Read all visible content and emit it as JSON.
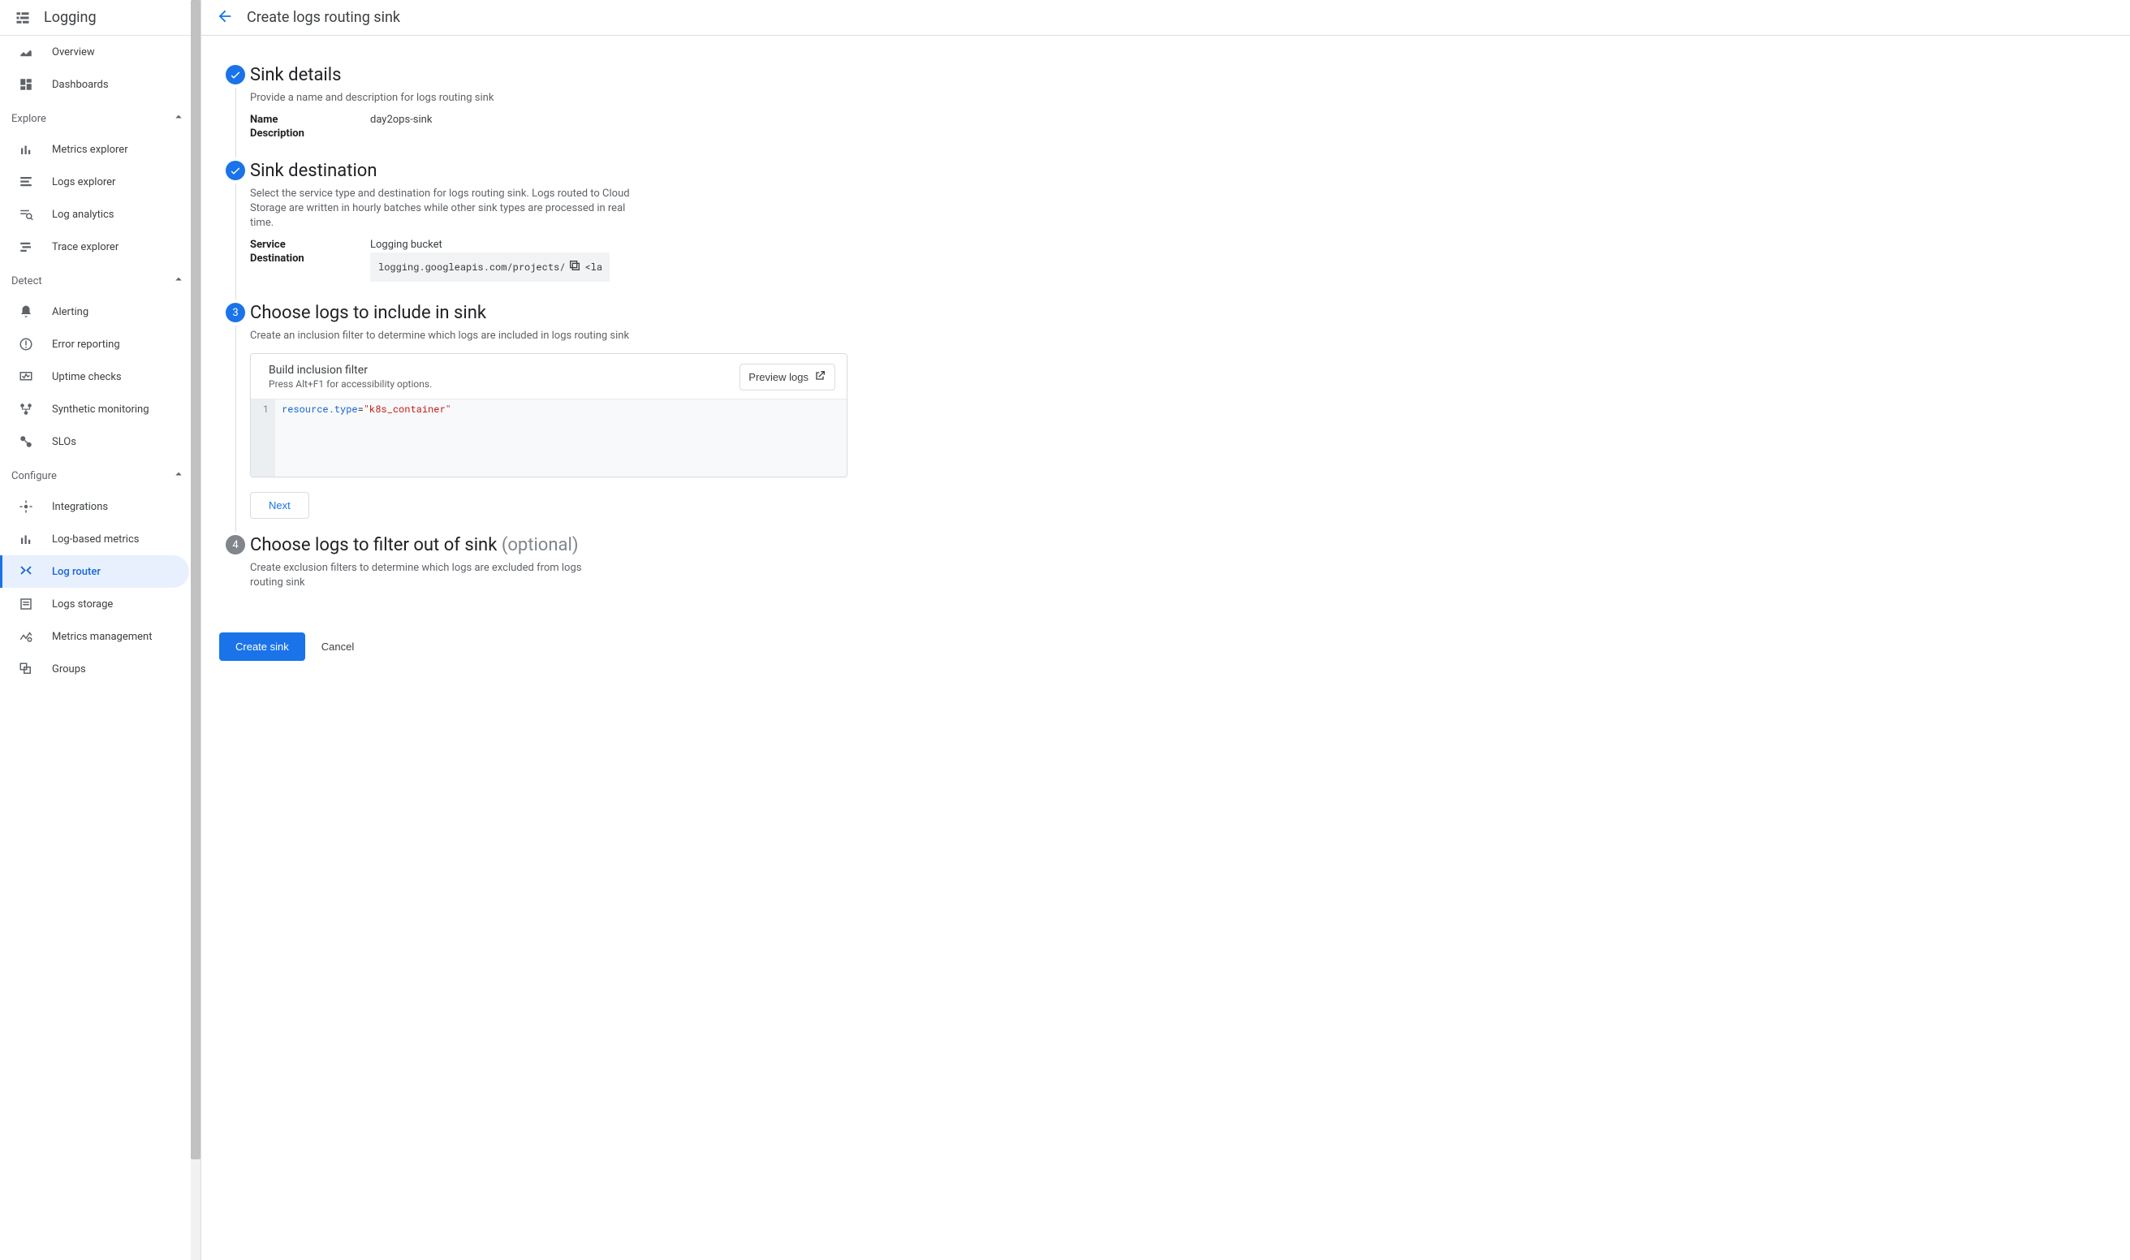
{
  "product": {
    "title": "Logging"
  },
  "header": {
    "page_title": "Create logs routing sink"
  },
  "sidebar": {
    "top": [
      {
        "label": "Overview",
        "icon": "insights"
      },
      {
        "label": "Dashboards",
        "icon": "dashboard"
      }
    ],
    "sections": {
      "explore": {
        "title": "Explore",
        "items": [
          {
            "label": "Metrics explorer",
            "icon": "bars"
          },
          {
            "label": "Logs explorer",
            "icon": "logs"
          },
          {
            "label": "Log analytics",
            "icon": "analytics"
          },
          {
            "label": "Trace explorer",
            "icon": "trace"
          }
        ]
      },
      "detect": {
        "title": "Detect",
        "items": [
          {
            "label": "Alerting",
            "icon": "bell"
          },
          {
            "label": "Error reporting",
            "icon": "error"
          },
          {
            "label": "Uptime checks",
            "icon": "uptime"
          },
          {
            "label": "Synthetic monitoring",
            "icon": "synthetic"
          },
          {
            "label": "SLOs",
            "icon": "slo"
          }
        ]
      },
      "configure": {
        "title": "Configure",
        "items": [
          {
            "label": "Integrations",
            "icon": "integrations"
          },
          {
            "label": "Log-based metrics",
            "icon": "bars"
          },
          {
            "label": "Log router",
            "icon": "router",
            "selected": true
          },
          {
            "label": "Logs storage",
            "icon": "storage"
          },
          {
            "label": "Metrics management",
            "icon": "mm"
          },
          {
            "label": "Groups",
            "icon": "groups"
          }
        ]
      }
    }
  },
  "steps": {
    "s1": {
      "title": "Sink details",
      "subtitle": "Provide a name and description for logs routing sink",
      "name_label": "Name",
      "name_value": "day2ops-sink",
      "desc_label": "Description",
      "desc_value": ""
    },
    "s2": {
      "title": "Sink destination",
      "subtitle": "Select the service type and destination for logs routing sink. Logs routed to Cloud Storage are written in hourly batches while other sink types are processed in real time.",
      "service_label": "Service",
      "service_value": "Logging bucket",
      "dest_label": "Destination",
      "dest_value": "logging.googleapis.com/projects/",
      "dest_tail": "<la"
    },
    "s3": {
      "number": "3",
      "title": "Choose logs to include in sink",
      "subtitle": "Create an inclusion filter to determine which logs are included in logs routing sink",
      "card": {
        "title": "Build inclusion filter",
        "hint": "Press Alt+F1 for accessibility options.",
        "preview_label": "Preview logs",
        "line_no": "1",
        "code_prop": "resource.type",
        "code_op": "=",
        "code_str": "\"k8s_container\""
      },
      "next_label": "Next"
    },
    "s4": {
      "number": "4",
      "title": "Choose logs to filter out of sink ",
      "optional": "(optional)",
      "subtitle": "Create exclusion filters to determine which logs are excluded from logs routing sink"
    }
  },
  "actions": {
    "create": "Create sink",
    "cancel": "Cancel"
  }
}
